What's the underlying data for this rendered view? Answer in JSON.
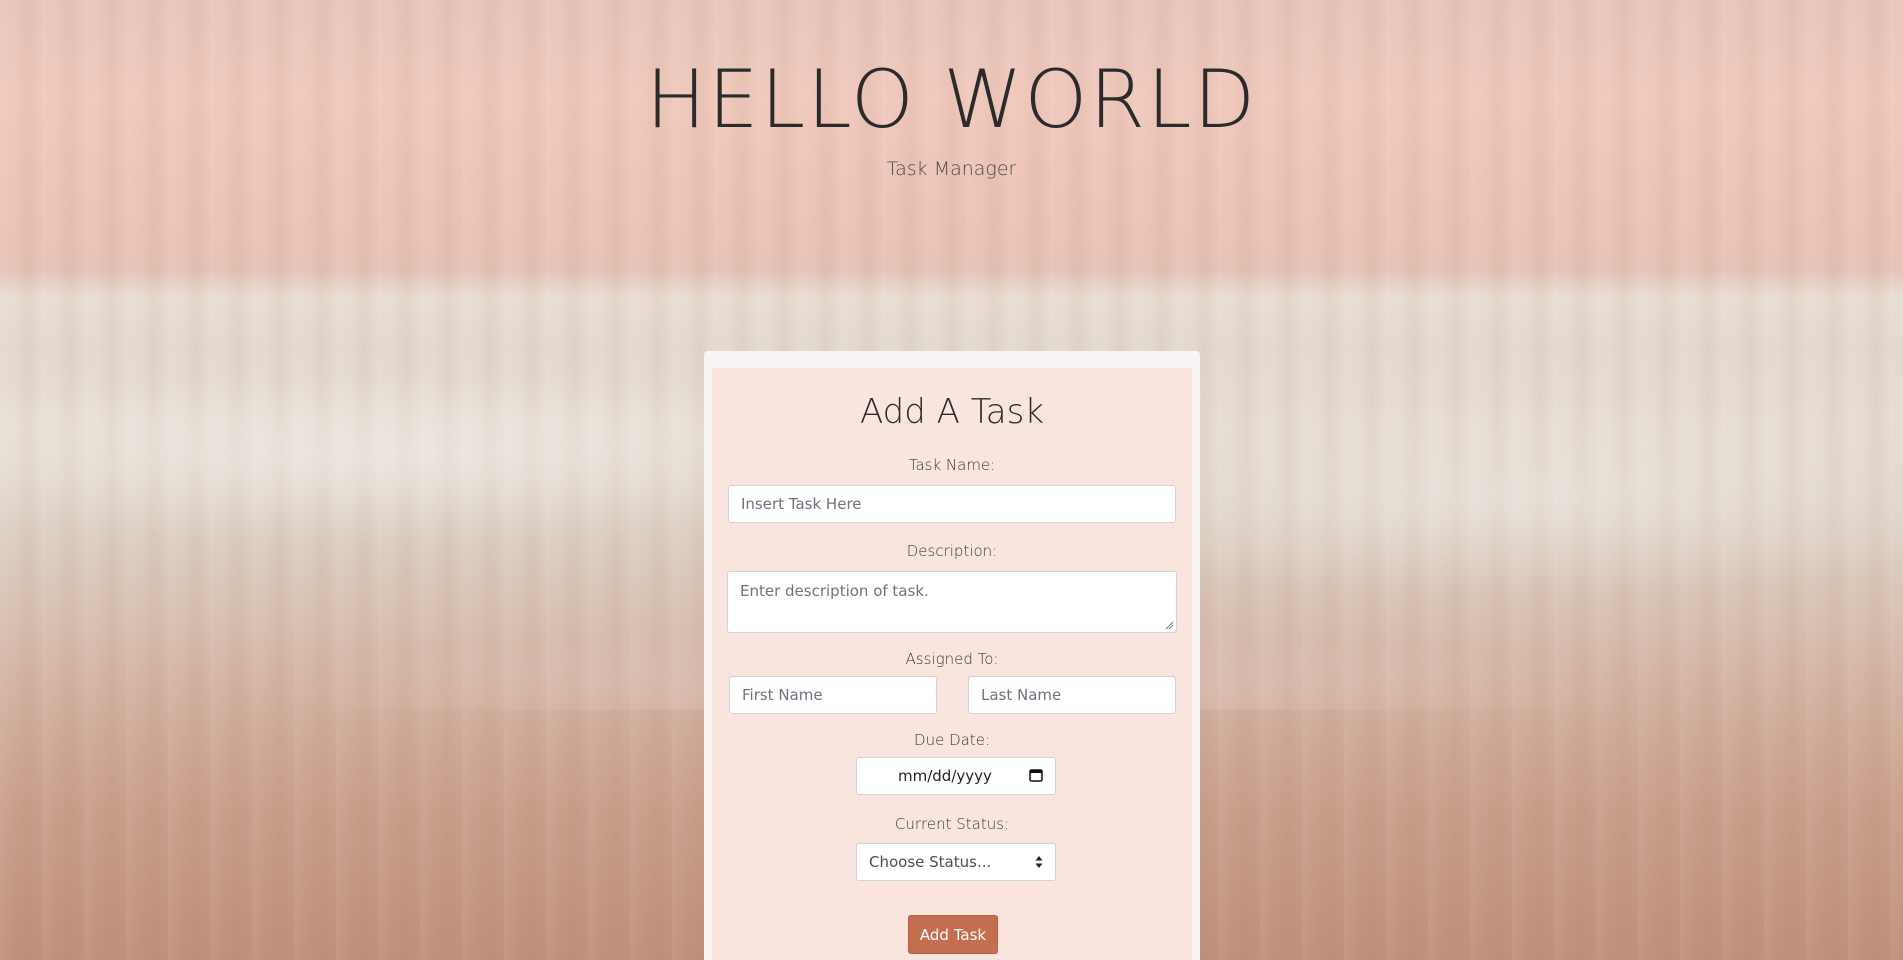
{
  "header": {
    "title": "HELLO WORLD",
    "subtitle": "Task Manager"
  },
  "form": {
    "heading": "Add A Task",
    "task_name": {
      "label": "Task Name:",
      "placeholder": "Insert Task Here"
    },
    "description": {
      "label": "Description:",
      "placeholder": "Enter description of task."
    },
    "assigned_to": {
      "label": "Assigned To:",
      "first_placeholder": "First Name",
      "last_placeholder": "Last Name"
    },
    "due_date": {
      "label": "Due Date:",
      "placeholder": "mm/dd/yyyy",
      "icon": "calendar-icon"
    },
    "status": {
      "label": "Current Status:",
      "selected": "Choose Status...",
      "icon": "select-caret-icon"
    },
    "submit_label": "Add Task"
  },
  "colors": {
    "card_bg": "#f9e5dd",
    "button": "#c46f50"
  }
}
